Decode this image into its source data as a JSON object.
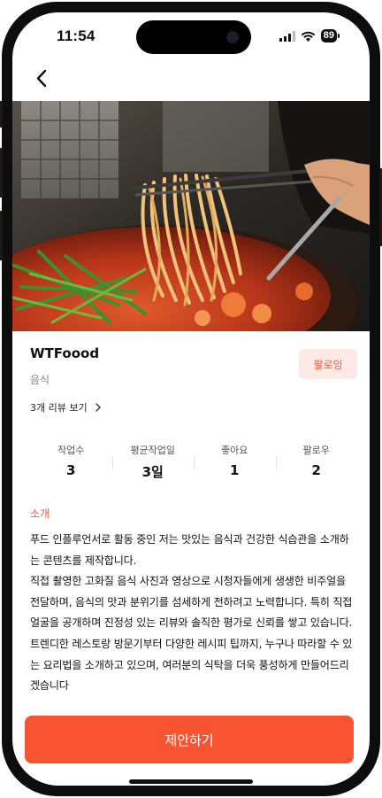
{
  "status_bar": {
    "time": "11:54",
    "battery_percent": "89",
    "icons": [
      "cellular-signal-icon",
      "wifi-icon",
      "battery-icon"
    ]
  },
  "nav": {
    "back_icon": "chevron-left-icon"
  },
  "hero": {
    "image": "photo-noodles-with-chopsticks-hotpot"
  },
  "profile": {
    "name": "WTFoood",
    "category": "음식",
    "follow_label": "팔로잉",
    "reviews_label": "3개 리뷰 보기",
    "reviews_chevron": "chevron-right-icon"
  },
  "stats": [
    {
      "label": "작업수",
      "value": "3"
    },
    {
      "label": "평균작업일",
      "value": "3일"
    },
    {
      "label": "좋아요",
      "value": "1"
    },
    {
      "label": "팔로우",
      "value": "2"
    }
  ],
  "intro": {
    "heading": "소개",
    "body": "푸드 인플루언서로 활동 중인 저는 맛있는 음식과 건강한 식습관을 소개하는 콘텐츠를 제작합니다.\n직접 촬영한 고화질 음식 사진과 영상으로 시청자들에게 생생한 비주얼을 전달하며, 음식의 맛과 분위기를 섬세하게 전하려고 노력합니다. 특히 직접 얼굴을 공개하며 진정성 있는 리뷰와 솔직한 평가로 신뢰를 쌓고 있습니다.\n트렌디한 레스토랑 방문기부터 다양한 레시피 팁까지, 누구나 따라할 수 있는 요리법을 소개하고 있으며, 여러분의 식탁을 더욱 풍성하게 만들어드리겠습니다"
  },
  "cta": {
    "label": "제안하기"
  },
  "colors": {
    "accent": "#f85432",
    "follow_bg": "#fdeae6",
    "follow_text": "#f2593b"
  }
}
